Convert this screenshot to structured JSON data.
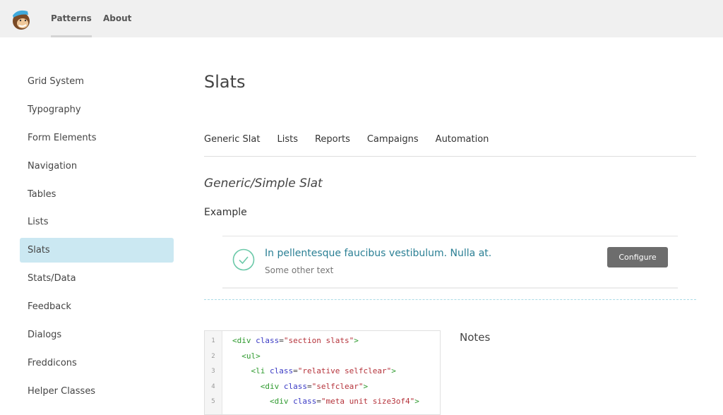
{
  "header": {
    "nav": [
      {
        "label": "Patterns",
        "active": true
      },
      {
        "label": "About",
        "active": false
      }
    ]
  },
  "sidebar": {
    "items": [
      "Grid System",
      "Typography",
      "Form Elements",
      "Navigation",
      "Tables",
      "Lists",
      "Slats",
      "Stats/Data",
      "Feedback",
      "Dialogs",
      "Freddicons",
      "Helper Classes"
    ],
    "active": "Slats"
  },
  "main": {
    "title": "Slats",
    "tabs": [
      "Generic Slat",
      "Lists",
      "Reports",
      "Campaigns",
      "Automation"
    ],
    "section_title": "Generic/Simple Slat",
    "example_label": "Example",
    "slat": {
      "title": "In pellentesque faucibus vestibulum. Nulla at.",
      "subtitle": "Some other text",
      "button": "Configure",
      "icon": "check-circle-icon"
    },
    "notes_label": "Notes",
    "code": {
      "line_numbers": [
        "1",
        "2",
        "3",
        "4",
        "5"
      ],
      "lines": [
        [
          {
            "c": "tag",
            "t": "<div "
          },
          {
            "c": "attr",
            "t": "class"
          },
          {
            "c": "pl",
            "t": "="
          },
          {
            "c": "str",
            "t": "\"section slats\""
          },
          {
            "c": "tag",
            "t": ">"
          }
        ],
        [
          {
            "c": "tag",
            "t": "  <ul>"
          }
        ],
        [
          {
            "c": "tag",
            "t": "    <li "
          },
          {
            "c": "attr",
            "t": "class"
          },
          {
            "c": "pl",
            "t": "="
          },
          {
            "c": "str",
            "t": "\"relative selfclear\""
          },
          {
            "c": "tag",
            "t": ">"
          }
        ],
        [
          {
            "c": "tag",
            "t": "      <div "
          },
          {
            "c": "attr",
            "t": "class"
          },
          {
            "c": "pl",
            "t": "="
          },
          {
            "c": "str",
            "t": "\"selfclear\""
          },
          {
            "c": "tag",
            "t": ">"
          }
        ],
        [
          {
            "c": "tag",
            "t": "        <div "
          },
          {
            "c": "attr",
            "t": "class"
          },
          {
            "c": "pl",
            "t": "="
          },
          {
            "c": "str",
            "t": "\"meta unit size3of4\""
          },
          {
            "c": "tag",
            "t": ">"
          }
        ]
      ]
    }
  },
  "colors": {
    "accent": "#2a7f94",
    "active_bg": "#cbe8f2",
    "check": "#6cc9a9",
    "button": "#6d6d6d"
  }
}
